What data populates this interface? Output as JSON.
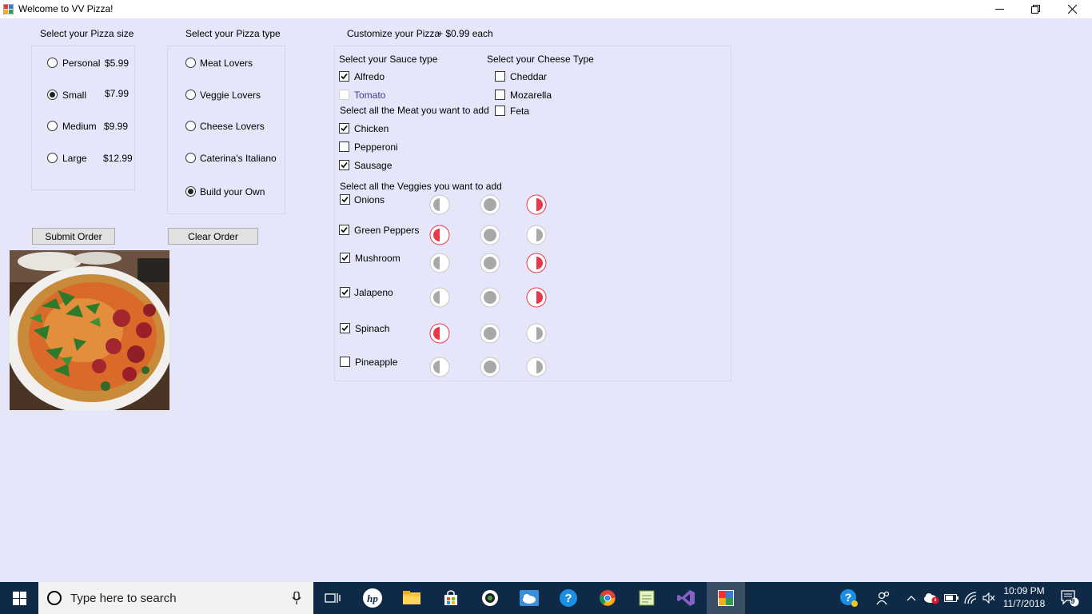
{
  "window": {
    "title": "Welcome to VV Pizza!"
  },
  "size": {
    "heading": "Select your Pizza size",
    "options": [
      {
        "label": "Personal",
        "price": "$5.99",
        "selected": false
      },
      {
        "label": "Small",
        "price": "$7.99",
        "selected": true
      },
      {
        "label": "Medium",
        "price": "$9.99",
        "selected": false
      },
      {
        "label": "Large",
        "price": "$12.99",
        "selected": false
      }
    ]
  },
  "type": {
    "heading": "Select your Pizza type",
    "options": [
      {
        "label": "Meat Lovers",
        "selected": false
      },
      {
        "label": "Veggie Lovers",
        "selected": false
      },
      {
        "label": "Cheese Lovers",
        "selected": false
      },
      {
        "label": "Caterina's Italiano",
        "selected": false
      },
      {
        "label": "Build your Own",
        "selected": true
      }
    ]
  },
  "customize": {
    "heading": "Customize your Pizza",
    "price_note": "+ $0.99 each",
    "sauce": {
      "heading": "Select your Sauce type",
      "options": [
        {
          "label": "Alfredo",
          "checked": true,
          "enabled": true
        },
        {
          "label": "Tomato",
          "checked": false,
          "enabled": false
        }
      ]
    },
    "cheese": {
      "heading": "Select your Cheese Type",
      "options": [
        {
          "label": "Cheddar",
          "checked": false
        },
        {
          "label": "Mozarella",
          "checked": false
        },
        {
          "label": "Feta",
          "checked": false
        }
      ]
    },
    "meat": {
      "heading": "Select all the Meat you want to add",
      "options": [
        {
          "label": "Chicken",
          "checked": true
        },
        {
          "label": "Pepperoni",
          "checked": false
        },
        {
          "label": "Sausage",
          "checked": true
        }
      ]
    },
    "veggies": {
      "heading": "Select all the Veggies you want to add",
      "options": [
        {
          "label": "Onions",
          "checked": true,
          "placement": "right"
        },
        {
          "label": "Green Peppers",
          "checked": true,
          "placement": "left"
        },
        {
          "label": "Mushroom",
          "checked": true,
          "placement": "right"
        },
        {
          "label": "Jalapeno",
          "checked": true,
          "placement": "right"
        },
        {
          "label": "Spinach",
          "checked": true,
          "placement": "left"
        },
        {
          "label": "Pineapple",
          "checked": false,
          "placement": "none"
        }
      ]
    }
  },
  "buttons": {
    "submit": "Submit Order",
    "clear": "Clear Order"
  },
  "taskbar": {
    "search_placeholder": "Type here to search",
    "time": "10:09 PM",
    "date": "11/7/2018",
    "notification_count": "9"
  },
  "colors": {
    "background": "#e6e6fa",
    "accent_red": "#e8394a",
    "toggle_gray": "#a8a8a8",
    "taskbar": "#0e2a47"
  }
}
